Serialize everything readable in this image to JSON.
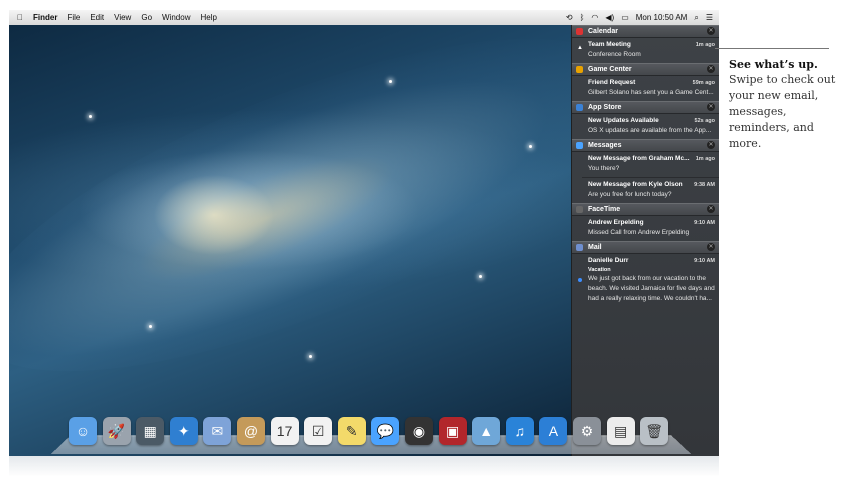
{
  "menubar": {
    "items": [
      "Finder",
      "File",
      "Edit",
      "View",
      "Go",
      "Window",
      "Help"
    ],
    "clock": "Mon 10:50 AM",
    "icons": [
      "apple-icon",
      "time-machine-icon",
      "bluetooth-icon",
      "wifi-icon",
      "volume-icon",
      "battery-icon",
      "spotlight-icon",
      "notification-center-icon"
    ]
  },
  "notifications": [
    {
      "app": "Calendar",
      "color": "#d33",
      "items": [
        {
          "title": "Team Meeting",
          "time": "1m ago",
          "body": "Conference Room",
          "flag": "▲"
        }
      ]
    },
    {
      "app": "Game Center",
      "color": "#e9a200",
      "items": [
        {
          "title": "Friend Request",
          "time": "59m ago",
          "body": "Gilbert Solano has sent you a Game Cent..."
        }
      ]
    },
    {
      "app": "App Store",
      "color": "#3b82d6",
      "items": [
        {
          "title": "New Updates Available",
          "time": "52s ago",
          "body": "OS X updates are available from the App..."
        }
      ]
    },
    {
      "app": "Messages",
      "color": "#4aa3ff",
      "items": [
        {
          "title": "New Message from Graham Mc...",
          "time": "1m ago",
          "body": "You there?"
        },
        {
          "title": "New Message from Kyle Olson",
          "time": "9:38 AM",
          "body": "Are you free for lunch today?"
        }
      ]
    },
    {
      "app": "FaceTime",
      "color": "#666",
      "items": [
        {
          "title": "Andrew Erpelding",
          "time": "9:10 AM",
          "body": "Missed Call from Andrew Erpelding"
        }
      ]
    },
    {
      "app": "Mail",
      "color": "#6f8fcf",
      "items": [
        {
          "title": "Danielle Durr",
          "time": "9:10 AM",
          "subtitle": "Vacation",
          "body": "We just got back from our vacation to the beach. We visited Jamaica for five days and had a really relaxing time.  We couldn't ha..."
        }
      ]
    }
  ],
  "caption": {
    "title": "See what’s up.",
    "text": "Swipe to check out your new email, messages, reminders, and more."
  },
  "dock": {
    "icons": [
      {
        "name": "finder-icon",
        "color": "#5aa0e6",
        "glyph": "☺"
      },
      {
        "name": "launchpad-icon",
        "color": "#9aa3ad",
        "glyph": "🚀"
      },
      {
        "name": "mission-control-icon",
        "color": "#4b5a66",
        "glyph": "▦"
      },
      {
        "name": "safari-icon",
        "color": "#2f7fd1",
        "glyph": "✦"
      },
      {
        "name": "mail-icon",
        "color": "#7ea3d8",
        "glyph": "✉"
      },
      {
        "name": "contacts-icon",
        "color": "#c49a5a",
        "glyph": "@"
      },
      {
        "name": "calendar-icon",
        "color": "#f2f2f2",
        "glyph": "17"
      },
      {
        "name": "reminders-icon",
        "color": "#f2f2f2",
        "glyph": "☑"
      },
      {
        "name": "notes-icon",
        "color": "#f3da6a",
        "glyph": "✎"
      },
      {
        "name": "messages-icon",
        "color": "#4aa3ff",
        "glyph": "💬"
      },
      {
        "name": "facetime-icon",
        "color": "#333",
        "glyph": "◉"
      },
      {
        "name": "photo-booth-icon",
        "color": "#b2262b",
        "glyph": "▣"
      },
      {
        "name": "iphoto-icon",
        "color": "#6fa7d8",
        "glyph": "▲"
      },
      {
        "name": "itunes-icon",
        "color": "#2a83d8",
        "glyph": "♫"
      },
      {
        "name": "app-store-icon",
        "color": "#2c7fd6",
        "glyph": "A"
      },
      {
        "name": "system-preferences-icon",
        "color": "#8a9098",
        "glyph": "⚙"
      },
      {
        "name": "document-icon",
        "color": "#ececec",
        "glyph": "▤"
      },
      {
        "name": "trash-icon",
        "color": "#b9c0c6",
        "glyph": "🗑"
      }
    ]
  }
}
